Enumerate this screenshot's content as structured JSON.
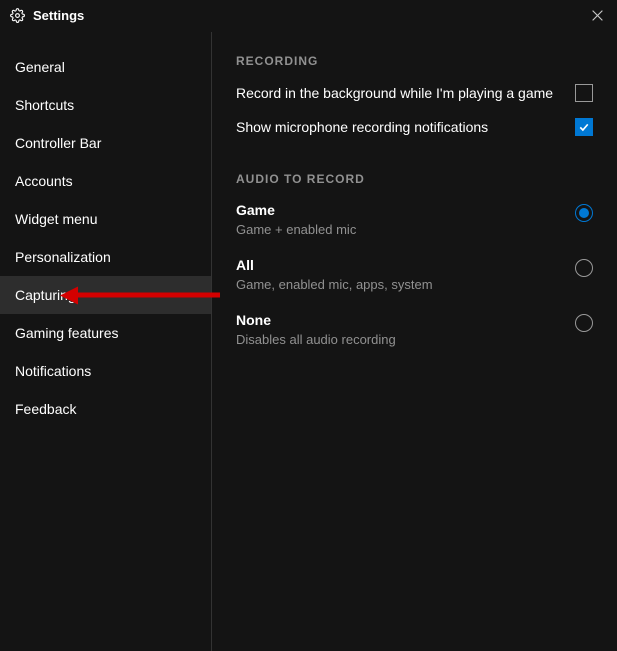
{
  "window": {
    "title": "Settings"
  },
  "sidebar": {
    "items": [
      {
        "label": "General"
      },
      {
        "label": "Shortcuts"
      },
      {
        "label": "Controller Bar"
      },
      {
        "label": "Accounts"
      },
      {
        "label": "Widget menu"
      },
      {
        "label": "Personalization"
      },
      {
        "label": "Capturing",
        "active": true
      },
      {
        "label": "Gaming features"
      },
      {
        "label": "Notifications"
      },
      {
        "label": "Feedback"
      }
    ]
  },
  "main": {
    "recording": {
      "header": "RECORDING",
      "record_bg": {
        "label": "Record in the background while I'm playing a game",
        "checked": false
      },
      "mic_notif": {
        "label": "Show microphone recording notifications",
        "checked": true
      }
    },
    "audio": {
      "header": "AUDIO TO RECORD",
      "options": [
        {
          "title": "Game",
          "desc": "Game + enabled mic",
          "selected": true
        },
        {
          "title": "All",
          "desc": "Game, enabled mic, apps, system",
          "selected": false
        },
        {
          "title": "None",
          "desc": "Disables all audio recording",
          "selected": false
        }
      ]
    }
  },
  "colors": {
    "accent": "#0078d4",
    "arrow": "#d40000"
  }
}
